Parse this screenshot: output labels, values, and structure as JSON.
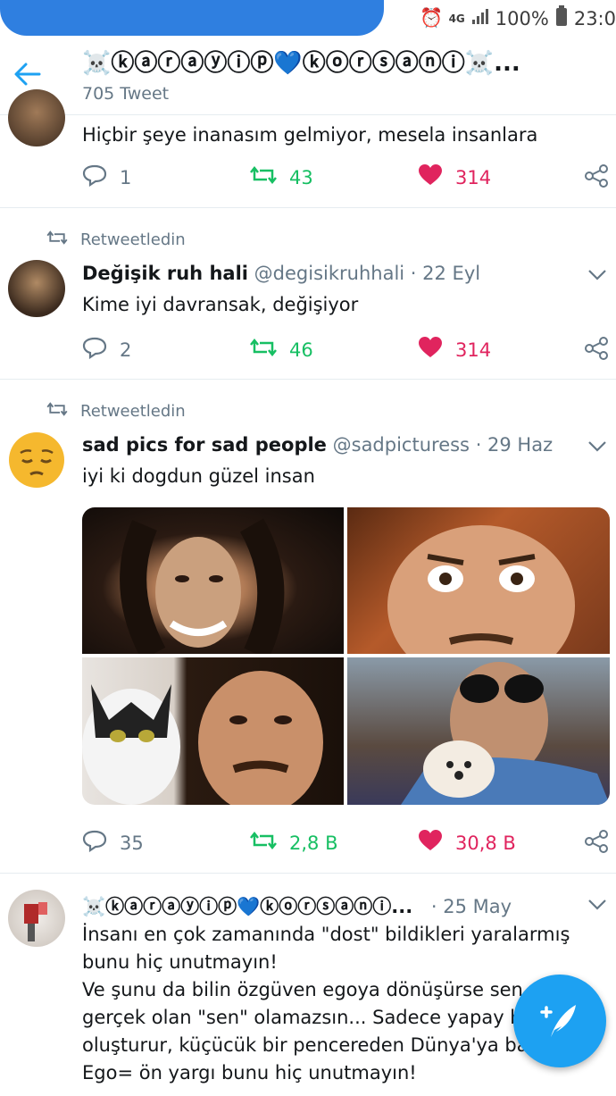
{
  "status_bar": {
    "battery": "100%",
    "time": "23:0",
    "network": "4G"
  },
  "header": {
    "title": "☠️ⓚⓐⓡⓐⓨⓘⓟ💙ⓚⓞⓡⓢⓐⓝⓘ☠️...",
    "tweet_count": "705 Tweet"
  },
  "tweets": [
    {
      "text": "Hiçbir şeye inanasım gelmiyor, mesela insanlara",
      "replies": "1",
      "retweets": "43",
      "likes": "314"
    },
    {
      "retweet_label": "Retweetledin",
      "name": "Değişik ruh hali",
      "handle": "@degisikruhhali",
      "date": "· 22 Eyl",
      "text": "Kime iyi davransak, değişiyor",
      "replies": "2",
      "retweets": "46",
      "likes": "314"
    },
    {
      "retweet_label": "Retweetledin",
      "name": "sad pics for sad people",
      "handle": "@sadpicturess",
      "date": "· 29 Haz",
      "text": "iyi ki dogdun güzel insan",
      "replies": "35",
      "retweets": "2,8 B",
      "likes": "30,8 B"
    },
    {
      "name": "☠️ⓚⓐⓡⓐⓨⓘⓟ💙ⓚⓞⓡⓢⓐⓝⓘ...",
      "date": "· 25 May",
      "lines": [
        "İnsanı en çok zamanında \"dost\" bildikleri yaralarmış",
        "bunu hiç unutmayın!",
        "Ve şunu da bilin özgüven egoya dönüşürse sen",
        "gerçek olan \"sen\" olamazsın... Sadece yapay b",
        "oluşturur, küçücük bir pencereden Dünya'ya ba",
        "Ego= ön yargı bunu hiç unutmayın!"
      ]
    }
  ],
  "colors": {
    "accent": "#1da1f2",
    "retweet": "#17bf63",
    "like": "#e0245e",
    "muted": "#657786"
  },
  "icons": [
    "back-arrow-icon",
    "reply-icon",
    "retweet-icon",
    "heart-icon",
    "share-icon",
    "chevron-down-icon",
    "compose-icon"
  ]
}
